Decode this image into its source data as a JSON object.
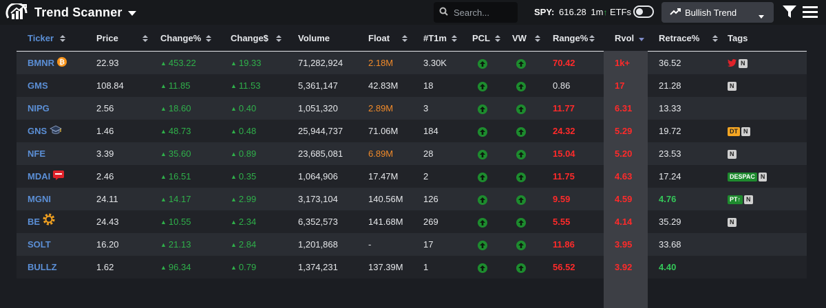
{
  "app": {
    "title": "Trend Scanner",
    "search_placeholder": "Search...",
    "spy_label": "SPY:",
    "spy_value": "616.28",
    "spy_timeframe": "1m",
    "spy_arrow": "↑",
    "etfs_label": "ETFs",
    "etfs_toggle_on": false,
    "trend_selector": "Bullish Trend"
  },
  "colors": {
    "ticker": "#5b8fd6",
    "positive": "#2fb04a",
    "orange": "#f08a2a",
    "red": "#ff2a2a"
  },
  "columns": [
    "Ticker",
    "Price",
    "Change%",
    "Change$",
    "Volume",
    "Float",
    "#T1m",
    "PCL",
    "VW",
    "Range%",
    "Rvol",
    "Retrace%",
    "Tags"
  ],
  "sorted_column": "Rvol",
  "rows": [
    {
      "ticker": "BMNR",
      "icon": "bitcoin-icon",
      "price": "22.93",
      "change_pct": "453.22",
      "change_dollar": "19.33",
      "volume": "71,282,924",
      "float": "2.18M",
      "float_color": "orange",
      "t1m": "3.30K",
      "pcl": "up",
      "vw": "up",
      "range": "70.42",
      "rvol": "1k+",
      "retrace": "36.52",
      "retrace_color": "white",
      "tags": [
        {
          "kind": "twitter-icon"
        },
        {
          "kind": "n",
          "text": "N"
        }
      ]
    },
    {
      "ticker": "GMS",
      "icon": "",
      "price": "108.84",
      "change_pct": "11.85",
      "change_dollar": "11.53",
      "volume": "5,361,147",
      "float": "42.83M",
      "float_color": "white",
      "t1m": "18",
      "pcl": "up",
      "vw": "up",
      "range": "0.86",
      "range_color": "white",
      "rvol": "17",
      "retrace": "21.28",
      "retrace_color": "white",
      "tags": [
        {
          "kind": "n",
          "text": "N"
        }
      ]
    },
    {
      "ticker": "NIPG",
      "icon": "",
      "price": "2.56",
      "change_pct": "18.60",
      "change_dollar": "0.40",
      "volume": "1,051,320",
      "float": "2.89M",
      "float_color": "orange",
      "t1m": "3",
      "pcl": "up",
      "vw": "up",
      "range": "11.77",
      "rvol": "6.31",
      "retrace": "13.33",
      "retrace_color": "white",
      "tags": []
    },
    {
      "ticker": "GNS",
      "icon": "graduation-cap-icon",
      "price": "1.46",
      "change_pct": "48.73",
      "change_dollar": "0.48",
      "volume": "25,944,737",
      "float": "71.06M",
      "float_color": "white",
      "t1m": "184",
      "pcl": "up",
      "vw": "up",
      "range": "24.32",
      "rvol": "5.29",
      "retrace": "19.72",
      "retrace_color": "white",
      "tags": [
        {
          "kind": "dt",
          "text": "DT"
        },
        {
          "kind": "n",
          "text": "N"
        }
      ]
    },
    {
      "ticker": "NFE",
      "icon": "",
      "price": "3.39",
      "change_pct": "35.60",
      "change_dollar": "0.89",
      "volume": "23,685,081",
      "float": "6.89M",
      "float_color": "orange",
      "t1m": "28",
      "pcl": "up",
      "vw": "up",
      "range": "15.04",
      "rvol": "5.20",
      "retrace": "23.53",
      "retrace_color": "white",
      "tags": [
        {
          "kind": "n",
          "text": "N"
        }
      ]
    },
    {
      "ticker": "MDAI",
      "icon": "chat-icon",
      "price": "2.46",
      "change_pct": "16.51",
      "change_dollar": "0.35",
      "volume": "1,064,906",
      "float": "17.47M",
      "float_color": "white",
      "t1m": "2",
      "pcl": "up",
      "vw": "up",
      "range": "11.75",
      "rvol": "4.63",
      "retrace": "17.24",
      "retrace_color": "white",
      "tags": [
        {
          "kind": "despac",
          "text": "DESPAC"
        },
        {
          "kind": "n",
          "text": "N"
        }
      ]
    },
    {
      "ticker": "MGNI",
      "icon": "",
      "price": "24.11",
      "change_pct": "14.17",
      "change_dollar": "2.99",
      "volume": "3,173,104",
      "float": "140.56M",
      "float_color": "white",
      "t1m": "126",
      "pcl": "up",
      "vw": "up",
      "range": "9.59",
      "rvol": "4.59",
      "retrace": "4.76",
      "retrace_color": "green",
      "tags": [
        {
          "kind": "pt",
          "text": "PT↑"
        },
        {
          "kind": "n",
          "text": "N"
        }
      ]
    },
    {
      "ticker": "BE",
      "icon": "gear-icon",
      "price": "24.43",
      "change_pct": "10.55",
      "change_dollar": "2.34",
      "volume": "6,352,573",
      "float": "141.68M",
      "float_color": "white",
      "t1m": "269",
      "pcl": "up",
      "vw": "up",
      "range": "5.55",
      "rvol": "4.14",
      "retrace": "35.29",
      "retrace_color": "white",
      "tags": [
        {
          "kind": "n",
          "text": "N"
        }
      ]
    },
    {
      "ticker": "SOLT",
      "icon": "",
      "price": "16.20",
      "change_pct": "21.13",
      "change_dollar": "2.84",
      "volume": "1,201,868",
      "float": "-",
      "float_color": "white",
      "t1m": "17",
      "pcl": "up",
      "vw": "up",
      "range": "11.86",
      "rvol": "3.95",
      "retrace": "33.68",
      "retrace_color": "white",
      "tags": []
    },
    {
      "ticker": "BULLZ",
      "icon": "",
      "price": "1.62",
      "change_pct": "96.34",
      "change_dollar": "0.79",
      "volume": "1,374,231",
      "float": "137.39M",
      "float_color": "white",
      "t1m": "1",
      "pcl": "up",
      "vw": "up",
      "range": "56.52",
      "rvol": "3.92",
      "retrace": "4.40",
      "retrace_color": "green",
      "tags": []
    }
  ]
}
